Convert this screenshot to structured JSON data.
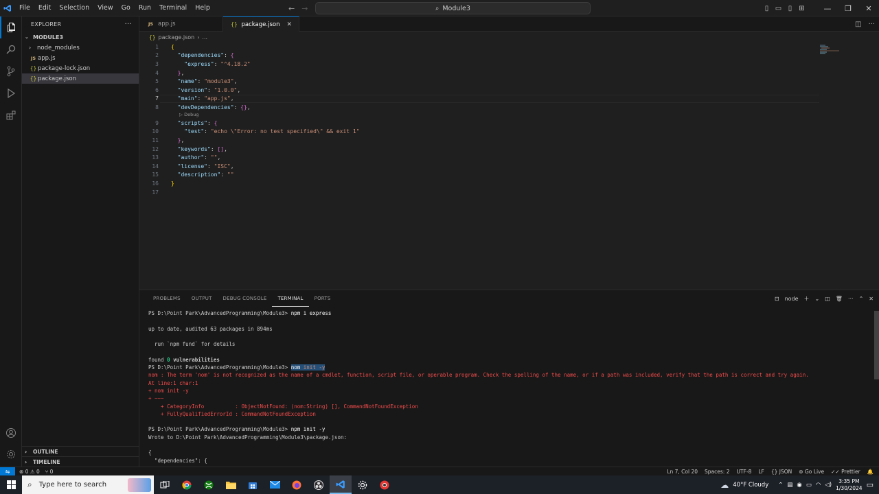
{
  "titlebar": {
    "menu": [
      "File",
      "Edit",
      "Selection",
      "View",
      "Go",
      "Run",
      "Terminal",
      "Help"
    ],
    "search_text": "Module3"
  },
  "explorer": {
    "header": "EXPLORER",
    "folder": "MODULE3",
    "items": [
      {
        "label": "node_modules",
        "type": "folder"
      },
      {
        "label": "package-lock.json",
        "type": "json"
      },
      {
        "label": "app.js",
        "type": "js"
      },
      {
        "label": "package.json",
        "type": "json",
        "selected": true
      }
    ],
    "outline": "OUTLINE",
    "timeline": "TIMELINE"
  },
  "tabs": [
    {
      "label": "app.js",
      "type": "js",
      "active": false
    },
    {
      "label": "package.json",
      "type": "json",
      "active": true
    }
  ],
  "breadcrumb": {
    "file": "package.json",
    "rest": "..."
  },
  "editor": {
    "current_line": 7,
    "debug_lens": "Debug",
    "lines": [
      {
        "n": "1"
      },
      {
        "n": "2"
      },
      {
        "n": "3"
      },
      {
        "n": "4"
      },
      {
        "n": "5"
      },
      {
        "n": "6"
      },
      {
        "n": "7"
      },
      {
        "n": "8"
      },
      {
        "n": "9"
      },
      {
        "n": "10"
      },
      {
        "n": "11"
      },
      {
        "n": "12"
      },
      {
        "n": "13"
      },
      {
        "n": "14"
      },
      {
        "n": "15"
      },
      {
        "n": "16"
      },
      {
        "n": "17"
      }
    ],
    "json": {
      "dependencies_key": "\"dependencies\"",
      "express_key": "\"express\"",
      "express_val": "\"^4.18.2\"",
      "name_key": "\"name\"",
      "name_val": "\"module3\"",
      "version_key": "\"version\"",
      "version_val": "\"1.0.0\"",
      "main_key": "\"main\"",
      "main_val": "\"app.js\"",
      "devdeps_key": "\"devDependencies\"",
      "scripts_key": "\"scripts\"",
      "test_key": "\"test\"",
      "test_val": "\"echo \\\"Error: no test specified\\\" && exit 1\"",
      "keywords_key": "\"keywords\"",
      "author_key": "\"author\"",
      "author_val": "\"\"",
      "license_key": "\"license\"",
      "license_val": "\"ISC\"",
      "description_key": "\"description\"",
      "description_val": "\"\""
    }
  },
  "panel": {
    "tabs": [
      "PROBLEMS",
      "OUTPUT",
      "DEBUG CONSOLE",
      "TERMINAL",
      "PORTS"
    ],
    "active_tab": "TERMINAL",
    "terminal_name": "node",
    "terminal": {
      "l1_prompt": "PS D:\\Point Park\\AdvancedProgramming\\Module3> ",
      "l1_cmd": "npm i express",
      "l2": "up to date, audited 63 packages in 894ms",
      "l3": "  run `npm fund` for details",
      "l4a": "found ",
      "l4b": "0",
      "l4c": " vulnerabilities",
      "l5_prompt": "PS D:\\Point Park\\AdvancedProgramming\\Module3> ",
      "l5_cmd_a": "nom",
      "l5_cmd_b": " init -y",
      "e1": "nom : The term 'nom' is not recognized as the name of a cmdlet, function, script file, or operable program. Check the spelling of the name, or if a path was included, verify that the path is correct and try again.",
      "e2": "At line:1 char:1",
      "e3": "+ nom init -y",
      "e4": "+ ~~~",
      "e5": "    + CategoryInfo          : ObjectNotFound: (nom:String) [], CommandNotFoundException",
      "e6": "    + FullyQualifiedErrorId : CommandNotFoundException",
      "l6_prompt": "PS D:\\Point Park\\AdvancedProgramming\\Module3> ",
      "l6_cmd": "npm init -y",
      "l7": "Wrote to D:\\Point Park\\AdvancedProgramming\\Module3\\package.json:",
      "l8": "{",
      "l9": "  \"dependencies\": {"
    }
  },
  "statusbar": {
    "errors": "0",
    "warnings": "0",
    "ports": "0",
    "position": "Ln 7, Col 20",
    "spaces": "Spaces: 2",
    "encoding": "UTF-8",
    "eol": "LF",
    "language": "JSON",
    "golive": "Go Live",
    "prettier": "Prettier"
  },
  "taskbar": {
    "search_placeholder": "Type here to search",
    "weather": "40°F  Cloudy",
    "time": "3:35 PM",
    "date": "1/30/2024"
  }
}
